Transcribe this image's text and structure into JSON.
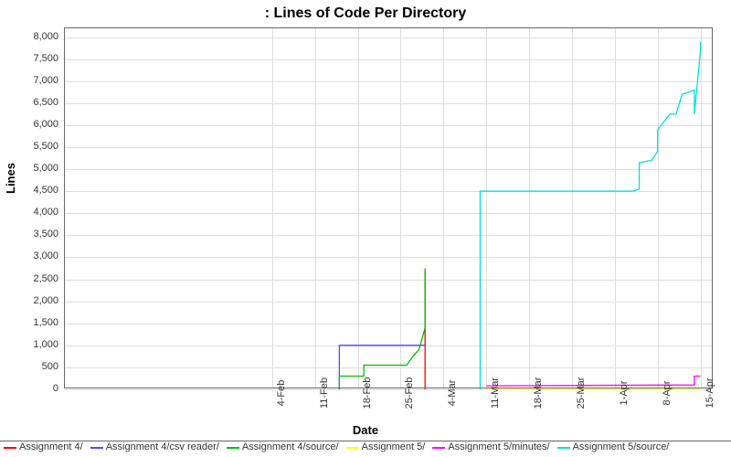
{
  "title": ": Lines of Code Per Directory",
  "xlabel": "Date",
  "ylabel": "Lines",
  "chart_data": {
    "type": "line",
    "xlabel": "Date",
    "ylabel": "Lines",
    "title": "Lines of Code Per Directory",
    "ylim": [
      0,
      8200
    ],
    "x_categories": [
      "4-Feb",
      "11-Feb",
      "18-Feb",
      "25-Feb",
      "4-Mar",
      "11-Mar",
      "18-Mar",
      "25-Mar",
      "1-Apr",
      "8-Apr",
      "15-Apr"
    ],
    "y_ticks": [
      0,
      500,
      1000,
      1500,
      2000,
      2500,
      3000,
      3500,
      4000,
      4500,
      5000,
      5500,
      6000,
      6500,
      7000,
      7500,
      8000
    ],
    "series": [
      {
        "name": "Assignment 4/",
        "color": "#ff0000",
        "points": [
          {
            "x": "1-Mar",
            "y": 0
          },
          {
            "x": "1-Mar",
            "y": 2700
          }
        ]
      },
      {
        "name": "Assignment 4/csv reader/",
        "color": "#4a4aff",
        "points": [
          {
            "x": "15-Feb",
            "y": 0
          },
          {
            "x": "15-Feb",
            "y": 1000
          },
          {
            "x": "1-Mar",
            "y": 1000
          }
        ]
      },
      {
        "name": "Assignment 4/source/",
        "color": "#00c000",
        "points": [
          {
            "x": "15-Feb",
            "y": 0
          },
          {
            "x": "15-Feb",
            "y": 300
          },
          {
            "x": "19-Feb",
            "y": 300
          },
          {
            "x": "19-Feb",
            "y": 550
          },
          {
            "x": "26-Feb",
            "y": 550
          },
          {
            "x": "27-Feb",
            "y": 750
          },
          {
            "x": "28-Feb",
            "y": 900
          },
          {
            "x": "1-Mar",
            "y": 1400
          },
          {
            "x": "1-Mar",
            "y": 1800
          },
          {
            "x": "1-Mar",
            "y": 2750
          }
        ]
      },
      {
        "name": "Assignment 5/",
        "color": "#ffff00",
        "points": [
          {
            "x": "11-Mar",
            "y": 0
          },
          {
            "x": "15-Apr",
            "y": 0
          }
        ]
      },
      {
        "name": "Assignment 5/minutes/",
        "color": "#ff00ff",
        "points": [
          {
            "x": "11-Mar",
            "y": 80
          },
          {
            "x": "14-Apr",
            "y": 100
          },
          {
            "x": "14-Apr",
            "y": 300
          },
          {
            "x": "15-Apr",
            "y": 300
          }
        ]
      },
      {
        "name": "Assignment 5/source/",
        "color": "#00e0e0",
        "points": [
          {
            "x": "10-Mar",
            "y": 0
          },
          {
            "x": "10-Mar",
            "y": 4500
          },
          {
            "x": "4-Apr",
            "y": 4500
          },
          {
            "x": "5-Apr",
            "y": 4550
          },
          {
            "x": "5-Apr",
            "y": 5150
          },
          {
            "x": "7-Apr",
            "y": 5200
          },
          {
            "x": "8-Apr",
            "y": 5400
          },
          {
            "x": "8-Apr",
            "y": 5900
          },
          {
            "x": "10-Apr",
            "y": 6250
          },
          {
            "x": "11-Apr",
            "y": 6250
          },
          {
            "x": "12-Apr",
            "y": 6700
          },
          {
            "x": "14-Apr",
            "y": 6800
          },
          {
            "x": "14-Apr",
            "y": 6250
          },
          {
            "x": "15-Apr",
            "y": 7700
          },
          {
            "x": "15-Apr",
            "y": 7900
          }
        ]
      }
    ]
  },
  "legend": [
    {
      "label": "Assignment 4/",
      "color": "#ff0000"
    },
    {
      "label": "Assignment 4/csv reader/",
      "color": "#4a4aff"
    },
    {
      "label": "Assignment 4/source/",
      "color": "#00c000"
    },
    {
      "label": "Assignment 5/",
      "color": "#ffff00"
    },
    {
      "label": "Assignment 5/minutes/",
      "color": "#ff00ff"
    },
    {
      "label": "Assignment 5/source/",
      "color": "#00e0e0"
    }
  ]
}
